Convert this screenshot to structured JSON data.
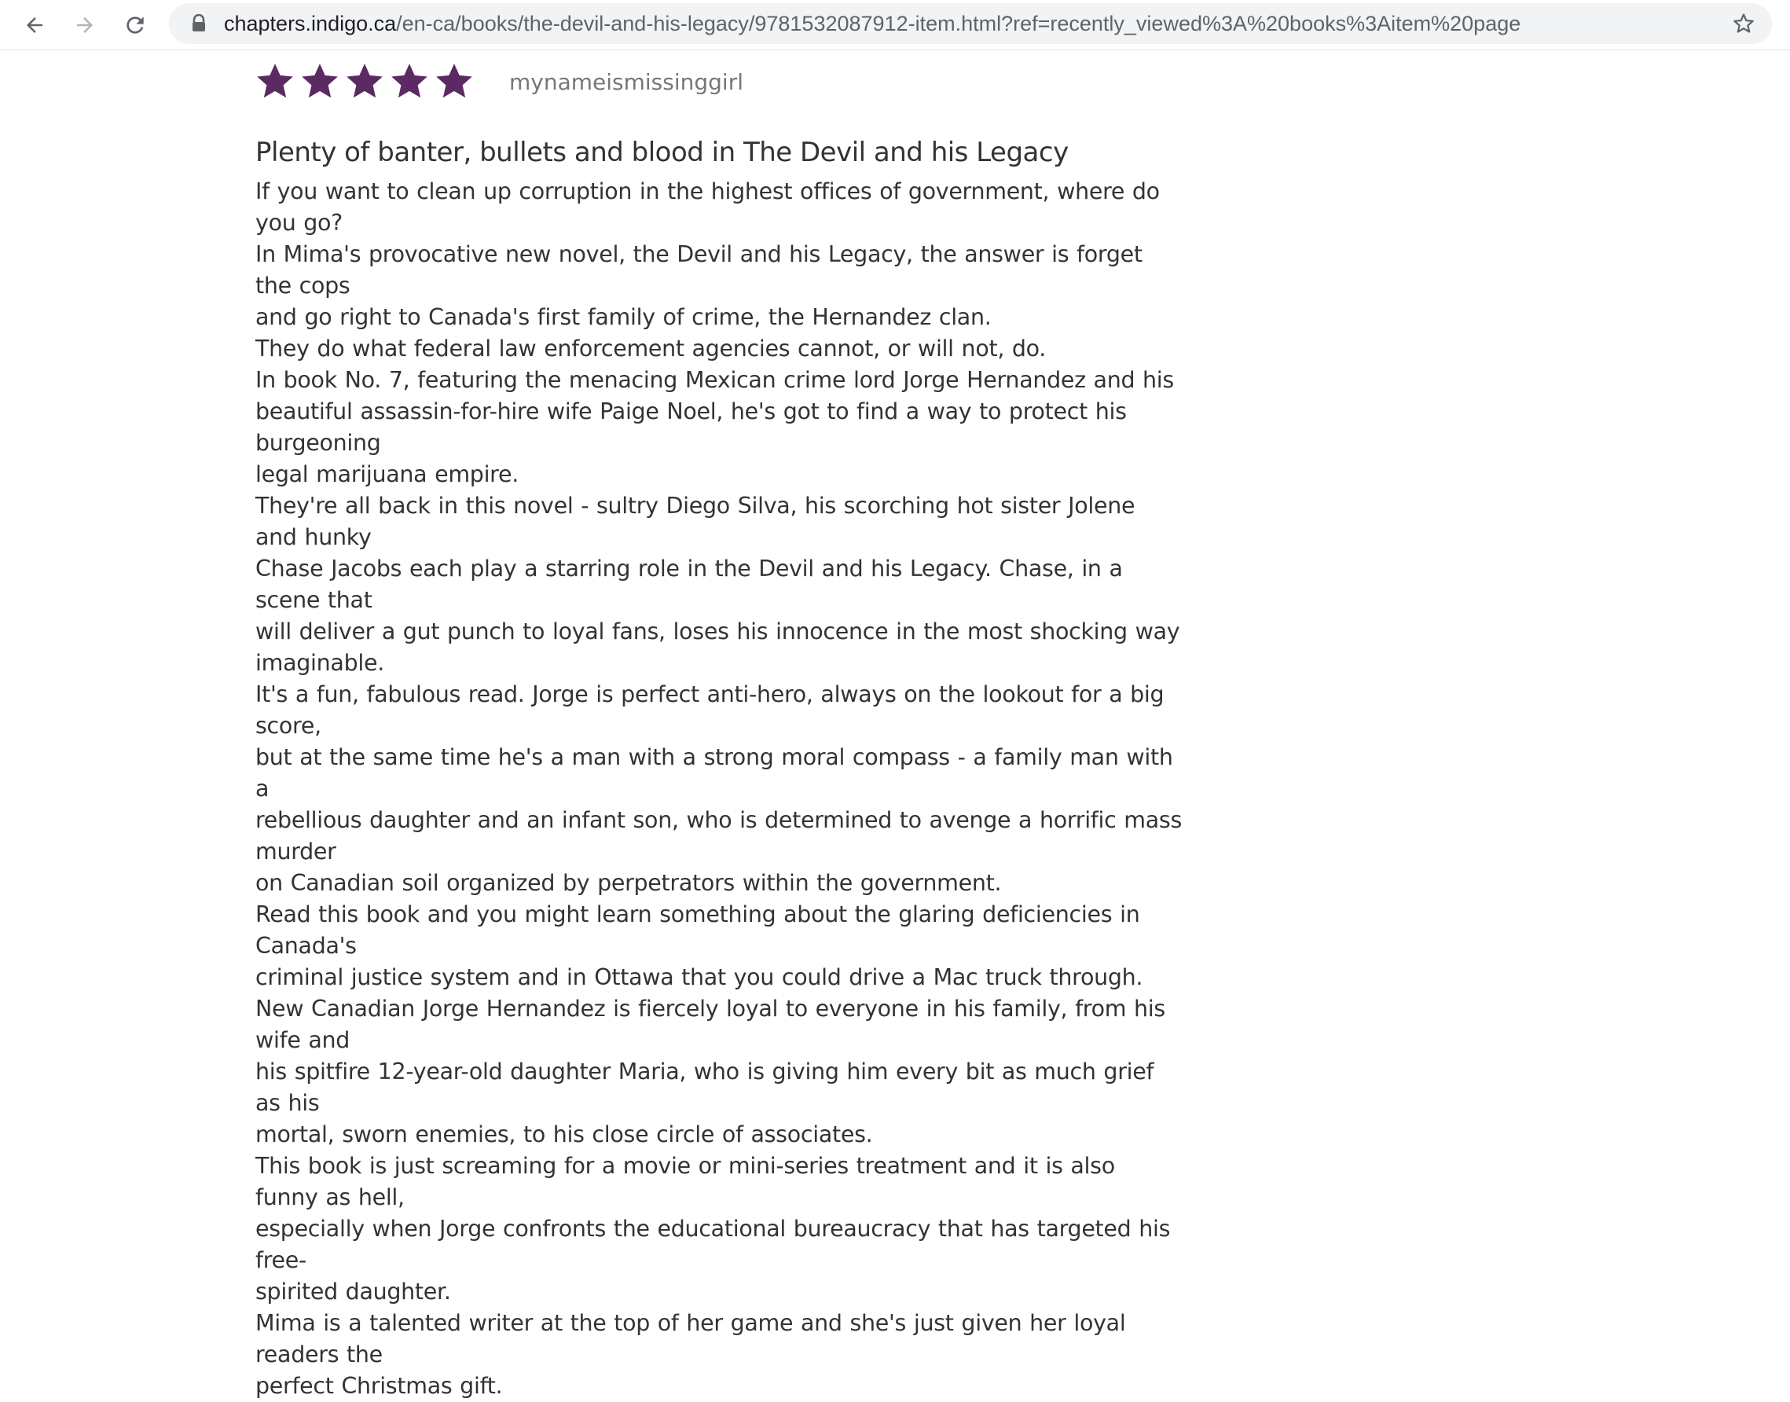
{
  "browser": {
    "url_host": "chapters.indigo.ca",
    "url_path": "/en-ca/books/the-devil-and-his-legacy/9781532087912-item.html?ref=recently_viewed%3A%20books%3Aitem%20page",
    "icons": [
      "back-arrow-icon",
      "forward-arrow-icon",
      "reload-icon",
      "lock-icon",
      "bookmark-star-icon"
    ]
  },
  "review": {
    "rating_stars": 5,
    "rating_max": 5,
    "star_color": "#5b2a62",
    "reviewer": "mynameismissinggirl",
    "title": "Plenty of banter, bullets and blood in The Devil and his Legacy",
    "lines": [
      "If you want to clean up corruption in the highest offices of government, where do you go?",
      "In Mima's provocative new novel, the Devil and his Legacy, the answer is forget the cops",
      "and go right to Canada's first family of crime, the Hernandez clan.",
      "They do what federal law enforcement agencies cannot, or will not, do.",
      "In book No. 7, featuring the menacing Mexican crime lord Jorge Hernandez and his",
      "beautiful assassin-for-hire wife Paige Noel, he's got to find a way to protect his burgeoning",
      "legal marijuana empire.",
      "They're all back in this novel - sultry Diego Silva, his scorching hot sister Jolene and hunky",
      "Chase Jacobs each play a starring role in the Devil and his Legacy. Chase, in a scene that",
      "will deliver a gut punch to loyal fans, loses his innocence in the most shocking way",
      "imaginable.",
      "It's a fun, fabulous read. Jorge is perfect anti-hero, always on the lookout for a big score,",
      "but at the same time he's a man with a strong moral compass - a family man with a",
      "rebellious daughter and an infant son, who is determined to avenge a horrific mass murder",
      "on Canadian soil organized by perpetrators within the government.",
      "Read this book and you might learn something about the glaring deficiencies in Canada's",
      "criminal justice system and in Ottawa that you could drive a Mac truck through.",
      "New Canadian Jorge Hernandez is fiercely loyal to everyone in his family, from his wife and",
      "his spitfire 12-year-old daughter Maria, who is giving him every bit as much grief as his",
      "mortal, sworn enemies, to his close circle of associates.",
      "This book is just screaming for a movie or mini-series treatment and it is also funny as hell,",
      "especially when Jorge confronts the educational bureaucracy that has targeted his free-",
      "spirited daughter.",
      "Mima is a talented writer at the top of her game and she's just given her loyal readers the",
      "perfect Christmas gift."
    ]
  }
}
